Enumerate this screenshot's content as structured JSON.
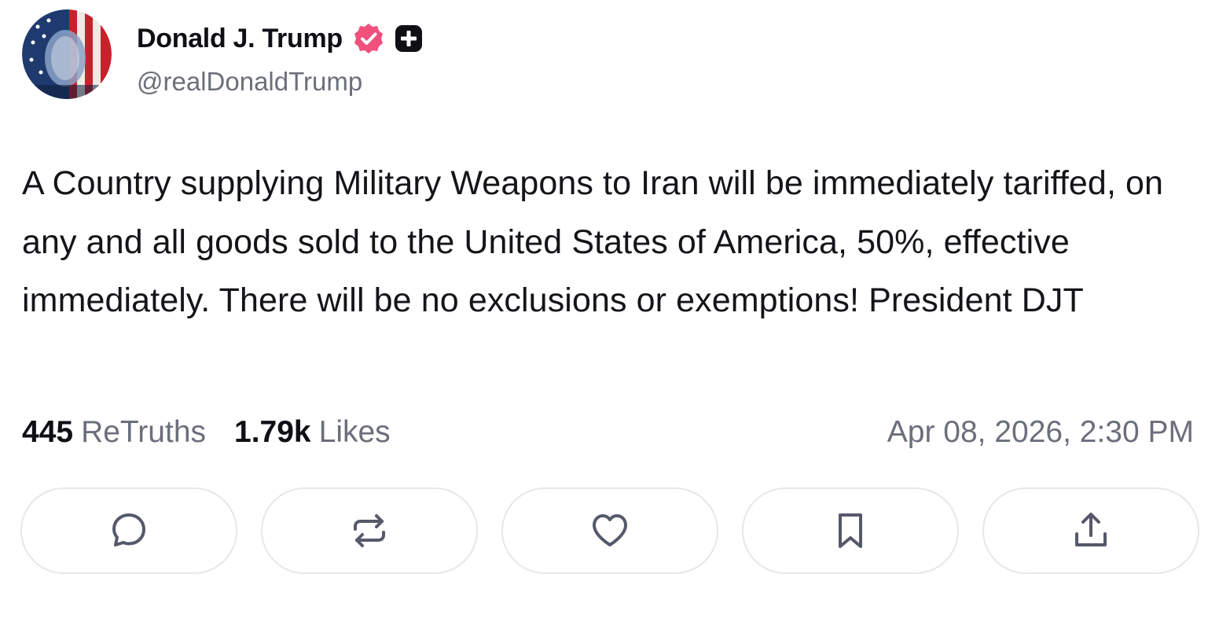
{
  "post": {
    "author": {
      "display_name": "Donald J. Trump",
      "handle": "@realDonaldTrump",
      "verified": true,
      "badge_color": "#f0507c"
    },
    "text": "A Country supplying Military Weapons to Iran will be immediately tariffed, on any and all goods sold to the United States of America, 50%, effective immediately. There will be no exclusions or exemptions! President DJT",
    "stats": {
      "retruths_count": "445",
      "retruths_label": "ReTruths",
      "likes_count": "1.79k",
      "likes_label": "Likes"
    },
    "timestamp": "Apr 08, 2026, 2:30 PM"
  },
  "actions": [
    {
      "name": "reply",
      "icon": "comment-icon"
    },
    {
      "name": "retruth",
      "icon": "repost-icon"
    },
    {
      "name": "like",
      "icon": "heart-icon"
    },
    {
      "name": "bookmark",
      "icon": "bookmark-icon"
    },
    {
      "name": "share",
      "icon": "share-icon"
    }
  ],
  "colors": {
    "text_primary": "#0f0f14",
    "text_secondary": "#6b6f7b",
    "button_border": "#e6e7ec",
    "icon": "#55596a"
  }
}
